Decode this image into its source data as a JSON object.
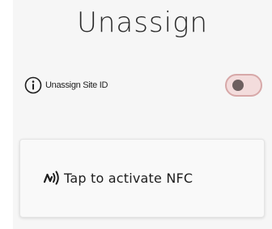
{
  "header": {
    "title": "Unassign"
  },
  "settings": {
    "unassign_site_id_label": "Unassign Site ID",
    "unassign_site_id_enabled": false
  },
  "nfc": {
    "label": "Tap to activate NFC"
  },
  "icons": {
    "info": "info-icon",
    "nfc": "nfc-icon"
  },
  "colors": {
    "toggle_track": "#f3dcdc",
    "toggle_border": "#d7a8a8",
    "toggle_knob": "#6d6060"
  }
}
